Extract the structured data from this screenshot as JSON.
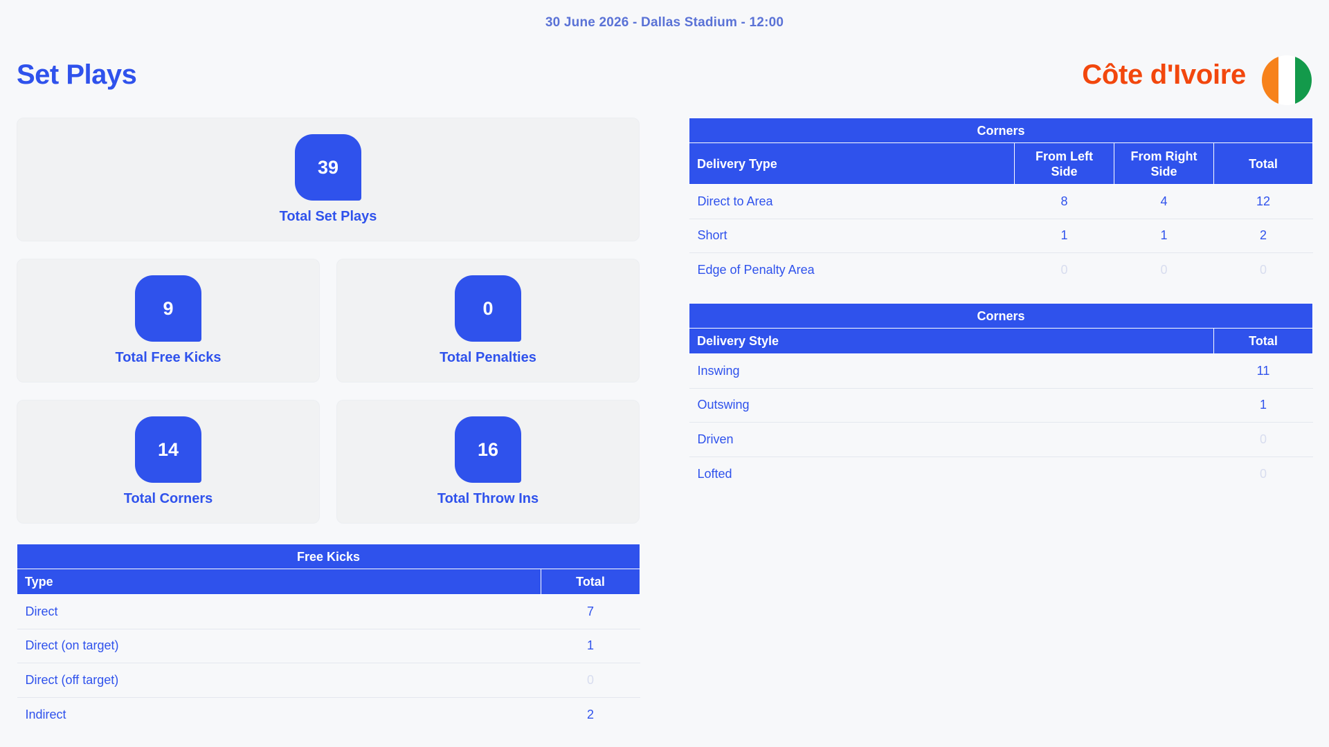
{
  "header": {
    "match_info": "30 June 2026 - Dallas Stadium - 12:00",
    "page_title": "Set Plays",
    "team_name": "Côte d'Ivoire",
    "flag_colors": [
      "#f7821b",
      "#ffffff",
      "#139a4b"
    ]
  },
  "summary": {
    "total_set_plays": {
      "value": "39",
      "label": "Total Set Plays"
    },
    "total_free_kicks": {
      "value": "9",
      "label": "Total Free Kicks"
    },
    "total_penalties": {
      "value": "0",
      "label": "Total Penalties"
    },
    "total_corners": {
      "value": "14",
      "label": "Total Corners"
    },
    "total_throw_ins": {
      "value": "16",
      "label": "Total Throw Ins"
    }
  },
  "free_kicks": {
    "caption": "Free Kicks",
    "columns": [
      "Type",
      "Total"
    ],
    "rows": [
      {
        "label": "Direct",
        "total": "7"
      },
      {
        "label": "Direct (on target)",
        "total": "1"
      },
      {
        "label": "Direct (off target)",
        "total": "0"
      },
      {
        "label": "Indirect",
        "total": "2"
      }
    ]
  },
  "corners_delivery_type": {
    "caption": "Corners",
    "columns": [
      "Delivery Type",
      "From Left Side",
      "From Right Side",
      "Total"
    ],
    "rows": [
      {
        "label": "Direct to Area",
        "left": "8",
        "right": "4",
        "total": "12"
      },
      {
        "label": "Short",
        "left": "1",
        "right": "1",
        "total": "2"
      },
      {
        "label": "Edge of Penalty Area",
        "left": "0",
        "right": "0",
        "total": "0"
      }
    ]
  },
  "corners_delivery_style": {
    "caption": "Corners",
    "columns": [
      "Delivery Style",
      "Total"
    ],
    "rows": [
      {
        "label": "Inswing",
        "total": "11"
      },
      {
        "label": "Outswing",
        "total": "1"
      },
      {
        "label": "Driven",
        "total": "0"
      },
      {
        "label": "Lofted",
        "total": "0"
      }
    ]
  },
  "colors": {
    "accent_blue": "#2f52ec",
    "team_orange": "#f2470d",
    "zero_value": "#d8ddef"
  }
}
